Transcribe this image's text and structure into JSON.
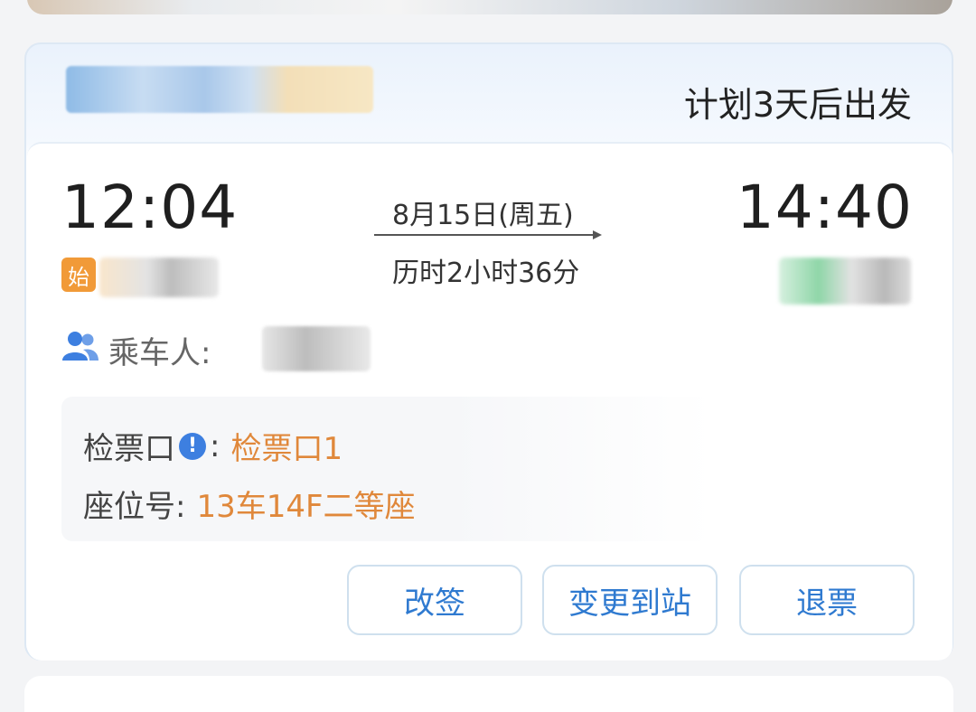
{
  "header": {
    "plan_text": "计划3天后出发"
  },
  "trip": {
    "departure_time": "12:04",
    "arrival_time": "14:40",
    "date": "8月15日(周五)",
    "duration": "历时2小时36分",
    "origin_badge": "始"
  },
  "passenger": {
    "label": "乘车人:"
  },
  "details": {
    "gate_label": "检票口",
    "gate_colon": ":",
    "gate_value": "检票口1",
    "seat_label": "座位号:",
    "seat_value": "13车14F二等座"
  },
  "actions": {
    "change_label": "改签",
    "change_station_label": "变更到站",
    "refund_label": "退票"
  },
  "colors": {
    "accent_blue": "#2f7ad0",
    "accent_orange": "#e0883b",
    "badge_orange": "#f19a38"
  }
}
